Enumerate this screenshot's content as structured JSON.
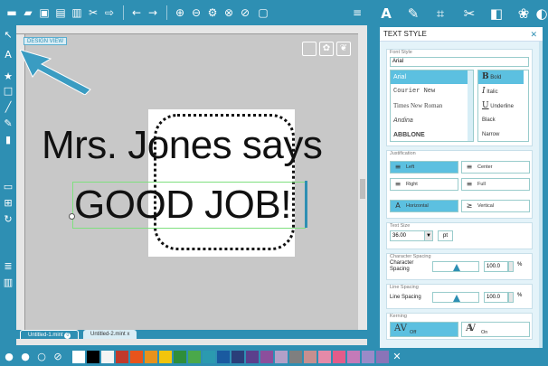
{
  "toolbar": {
    "icons": [
      "new-doc-icon",
      "open-folder-icon",
      "open-library-icon",
      "print-icon",
      "print-cut-icon",
      "cut-icon",
      "separator",
      "undo-icon",
      "redo-icon",
      "separator",
      "zoom-in-icon",
      "zoom-out-icon",
      "zoom-fit-icon",
      "zoom-selected-icon",
      "zoom-page-icon",
      "fullscreen-icon"
    ]
  },
  "right_tabs": [
    "text-icon",
    "pen-icon",
    "crop-icon",
    "knife-icon",
    "fill-icon",
    "palette-icon"
  ],
  "canvas": {
    "design_view_label": "DESIGN VIEW",
    "text_line1": "Mrs. Jones says",
    "text_line2": "GOOD JOB!"
  },
  "doc_tabs": [
    {
      "label": "Untitled-1.mint",
      "active": true,
      "badge": "0"
    },
    {
      "label": "Untitled-2.mint",
      "active": false,
      "badge": "x"
    }
  ],
  "palette": {
    "colors": [
      "#ffffff",
      "#000000",
      "#f4f4f4",
      "#c0392b",
      "#e8541c",
      "#e8921c",
      "#f2c50c",
      "#2e8e3a",
      "#4aa84a",
      "#2b9ab0",
      "#1a5aa0",
      "#2a3f7a",
      "#5b3f8c",
      "#8c4f9c",
      "#b3a0c8",
      "#7f7f7f",
      "#c78f8f",
      "#e58aa8",
      "#e35c8a",
      "#c47ab8",
      "#9a8ac8",
      "#8a74b8"
    ]
  },
  "panel": {
    "title": "TEXT STYLE",
    "font_style_label": "Font Style",
    "font_value": "Arial",
    "fonts": [
      "Arial",
      "Courier New",
      "Times New Roman",
      "Andina",
      "ABBLONE"
    ],
    "styles": [
      "Bold",
      "Italic",
      "Underline",
      "Black",
      "Narrow"
    ],
    "justification_label": "Justification",
    "justification": {
      "left": "Left",
      "center": "Center",
      "right": "Right",
      "full": "Full"
    },
    "orientation": {
      "horizontal": "Horizontal",
      "vertical": "Vertical"
    },
    "text_size_label": "Text Size",
    "text_size_value": "36.00",
    "text_size_unit": "pt",
    "char_spacing_section": "Character Spacing",
    "char_spacing_label": "Character Spacing",
    "char_spacing_value": "100.0",
    "char_spacing_unit": "%",
    "line_spacing_section": "Line Spacing",
    "line_spacing_label": "Line Spacing",
    "line_spacing_value": "100.0",
    "line_spacing_unit": "%",
    "kerning_label": "Kerning",
    "kerning_off": "Off",
    "kerning_on": "On",
    "kerning_icon_text": "AV"
  }
}
